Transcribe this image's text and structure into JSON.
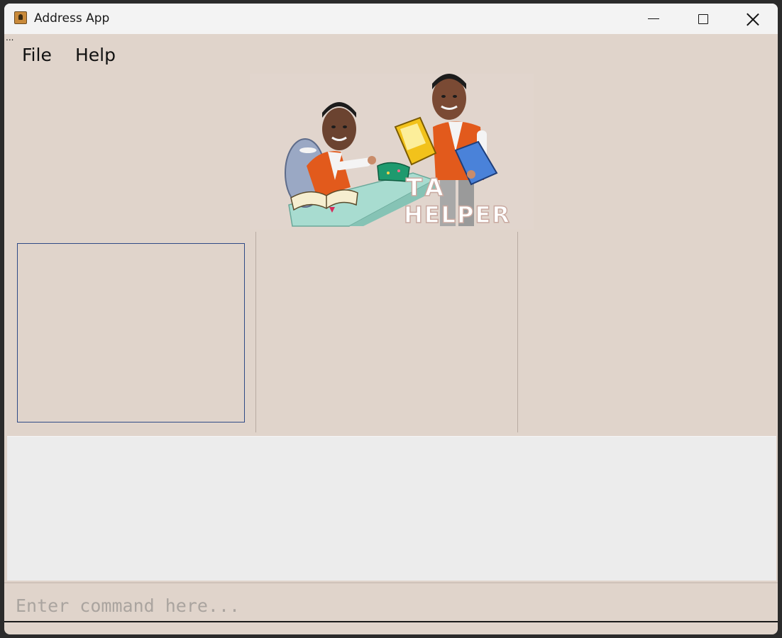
{
  "window": {
    "title": "Address App",
    "icon": "address-book-icon",
    "controls": [
      "minimize-icon",
      "maximize-icon",
      "close-icon"
    ]
  },
  "overflow_indicator": "...",
  "menu": {
    "items": [
      {
        "label": "File"
      },
      {
        "label": "Help"
      }
    ]
  },
  "banner": {
    "text_line1": "TA",
    "text_line2": "HELPER"
  },
  "command": {
    "placeholder": "Enter command here...",
    "value": ""
  },
  "colors": {
    "background": "#e0d4cb",
    "titlebar": "#f3f3f3",
    "result_bg": "#ececec",
    "list_border": "#2f4a86"
  }
}
